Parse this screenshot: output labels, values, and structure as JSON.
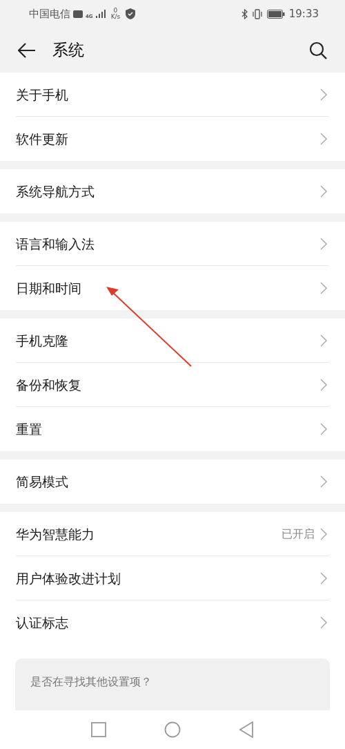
{
  "status_bar": {
    "carrier": "中国电信",
    "network": "4G",
    "speed_value": "0",
    "speed_unit": "K/s",
    "time": "19:33"
  },
  "header": {
    "title": "系统"
  },
  "groups": [
    {
      "items": [
        {
          "label": "关于手机"
        },
        {
          "label": "软件更新"
        }
      ]
    },
    {
      "items": [
        {
          "label": "系统导航方式"
        }
      ]
    },
    {
      "items": [
        {
          "label": "语言和输入法"
        },
        {
          "label": "日期和时间"
        }
      ]
    },
    {
      "items": [
        {
          "label": "手机克隆"
        },
        {
          "label": "备份和恢复"
        },
        {
          "label": "重置"
        }
      ]
    },
    {
      "items": [
        {
          "label": "简易模式"
        }
      ]
    },
    {
      "items": [
        {
          "label": "华为智慧能力",
          "value": "已开启"
        },
        {
          "label": "用户体验改进计划"
        },
        {
          "label": "认证标志"
        }
      ]
    }
  ],
  "suggestion_card": {
    "title": "是否在寻找其他设置项？"
  }
}
